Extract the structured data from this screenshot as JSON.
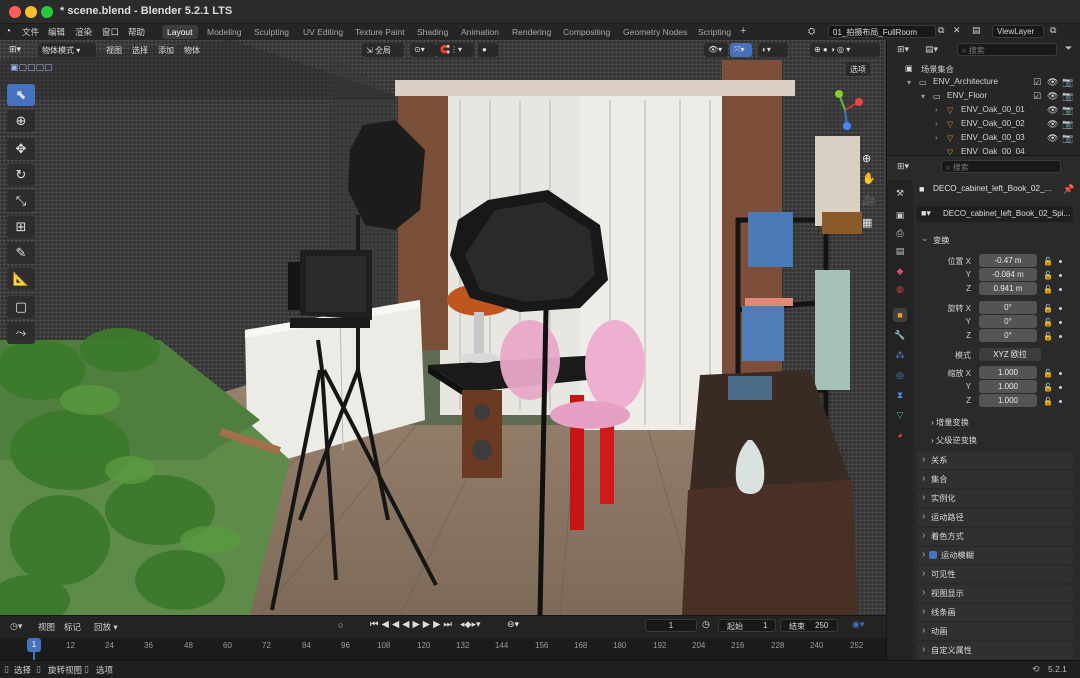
{
  "window": {
    "title": "* scene.blend - Blender 5.2.1 LTS"
  },
  "menu": {
    "file": "文件",
    "edit": "编辑",
    "render": "渲染",
    "window": "窗口",
    "help": "帮助"
  },
  "workspaces": [
    "Layout",
    "Modeling",
    "Sculpting",
    "UV Editing",
    "Texture Paint",
    "Shading",
    "Animation",
    "Rendering",
    "Compositing",
    "Geometry Nodes",
    "Scripting"
  ],
  "scene_name": "01_拍摄布局_FullRoom",
  "view_layer": "ViewLayer",
  "viewport_header": {
    "mode": "物体模式",
    "view": "视图",
    "select": "选择",
    "add": "添加",
    "object": "物体",
    "transform_orientation": "全局",
    "options": "选项"
  },
  "outliner": {
    "search_placeholder": "搜索",
    "root": "场景集合",
    "rows": [
      "ENV_Architecture",
      "ENV_Floor",
      "ENV_Oak_00_01",
      "ENV_Oak_00_02",
      "ENV_Oak_00_03",
      "ENV_Oak_00_04"
    ]
  },
  "properties": {
    "search_placeholder": "搜索",
    "object_name": "DECO_cabinet_left_Book_02_...",
    "mesh_name": "DECO_cabinet_left_Book_02_Spi...",
    "transform_label": "变换",
    "location_label": "位置 X",
    "rotation_label": "旋转 X",
    "mode_label": "模式",
    "scale_label": "缩放 X",
    "axis_y": "Y",
    "axis_z": "Z",
    "location": [
      "-0.47 m",
      "-0.084 m",
      "0.941 m"
    ],
    "rotation": [
      "0°",
      "0°",
      "0°"
    ],
    "rotation_mode": "XYZ 欧拉",
    "scale": [
      "1.000",
      "1.000",
      "1.000"
    ],
    "delta_transform": "增量变换",
    "parent_inverse": "父级逆变换",
    "panels": [
      "关系",
      "集合",
      "实例化",
      "运动路径",
      "着色方式",
      "运动模糊",
      "可见性",
      "视图显示",
      "线条画",
      "动画",
      "自定义属性"
    ]
  },
  "timeline": {
    "view": "视图",
    "marker": "标记",
    "playback": "回放",
    "current_frame": "1",
    "start_label": "起始",
    "start": "1",
    "end_label": "结束",
    "end": "250",
    "ticks": [
      "1",
      "12",
      "24",
      "36",
      "48",
      "60",
      "72",
      "84",
      "96",
      "108",
      "120",
      "132",
      "144",
      "156",
      "168",
      "180",
      "192",
      "204",
      "216",
      "228",
      "240",
      "252"
    ]
  },
  "status": {
    "select": "选择",
    "rotate_view": "旋转视图",
    "options": "选项",
    "version": "5.2.1"
  },
  "colors": {
    "accent": "#4671bd",
    "header": "#2b2b2b",
    "panel": "#2a2a2a"
  }
}
